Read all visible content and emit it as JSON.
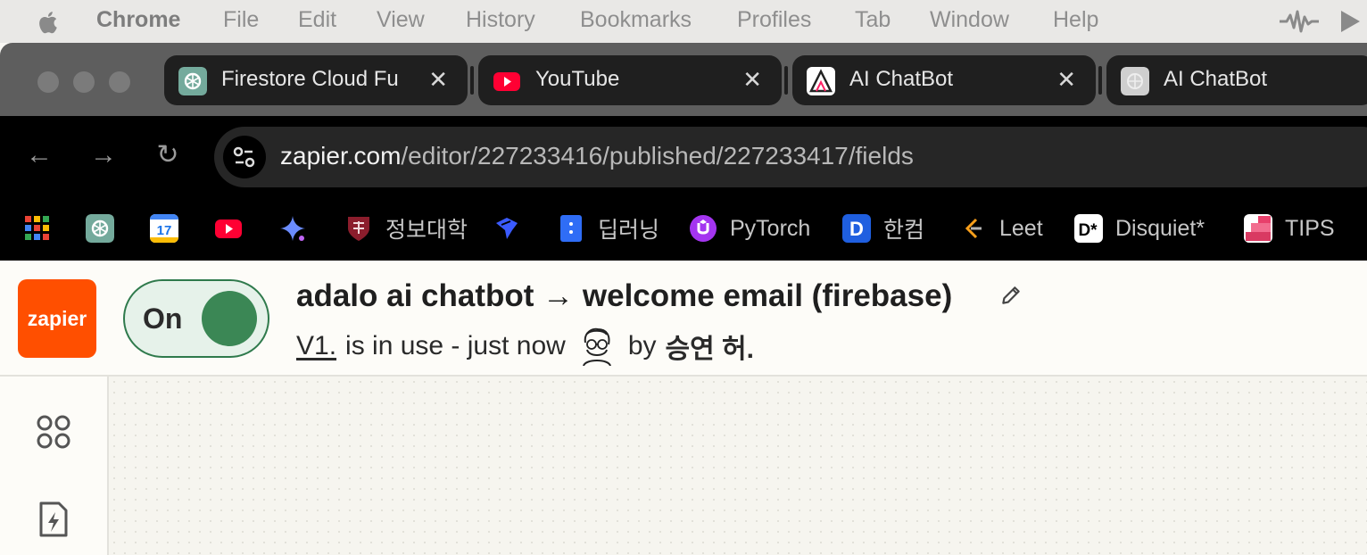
{
  "menubar": {
    "app": "Chrome",
    "items": [
      "File",
      "Edit",
      "View",
      "History",
      "Bookmarks",
      "Profiles",
      "Tab",
      "Window",
      "Help"
    ]
  },
  "tabs": [
    {
      "title": "Firestore Cloud Fu",
      "icon": "chatgpt-icon"
    },
    {
      "title": "YouTube",
      "icon": "youtube-icon"
    },
    {
      "title": "AI ChatBot",
      "icon": "adalo-icon"
    },
    {
      "title": "AI ChatBot",
      "icon": "globe-icon"
    }
  ],
  "toolbar": {
    "url_host": "zapier.com",
    "url_path": "/editor/227233416/published/227233417/fields"
  },
  "bookmarks": [
    {
      "label": "",
      "icon": "apps-grid-icon"
    },
    {
      "label": "",
      "icon": "chatgpt-icon"
    },
    {
      "label": "",
      "icon": "calendar-icon",
      "icon_text": "17"
    },
    {
      "label": "",
      "icon": "youtube-icon"
    },
    {
      "label": "",
      "icon": "gemini-icon"
    },
    {
      "label": "정보대학",
      "icon": "university-crest-icon"
    },
    {
      "label": "",
      "icon": "linear-icon"
    },
    {
      "label": "딥러닝",
      "icon": "doc-icon"
    },
    {
      "label": "PyTorch",
      "icon": "udemy-icon"
    },
    {
      "label": "한컴",
      "icon": "d-icon",
      "icon_text": "D"
    },
    {
      "label": "Leet",
      "icon": "leetcode-icon"
    },
    {
      "label": "Disquiet*",
      "icon": "disquiet-icon",
      "icon_text": "D*"
    },
    {
      "label": "TIPS",
      "icon": "tips-icon"
    }
  ],
  "zap": {
    "logo_text": "zapier",
    "toggle_label": "On",
    "title": "adalo ai chatbot → welcome email (firebase)",
    "version": "V1.",
    "status": "is in use - just now",
    "by": "by",
    "user": "승연 허."
  },
  "colors": {
    "zapier_orange": "#ff4f00",
    "toggle_green": "#3b8755",
    "youtube_red": "#ff0033"
  }
}
